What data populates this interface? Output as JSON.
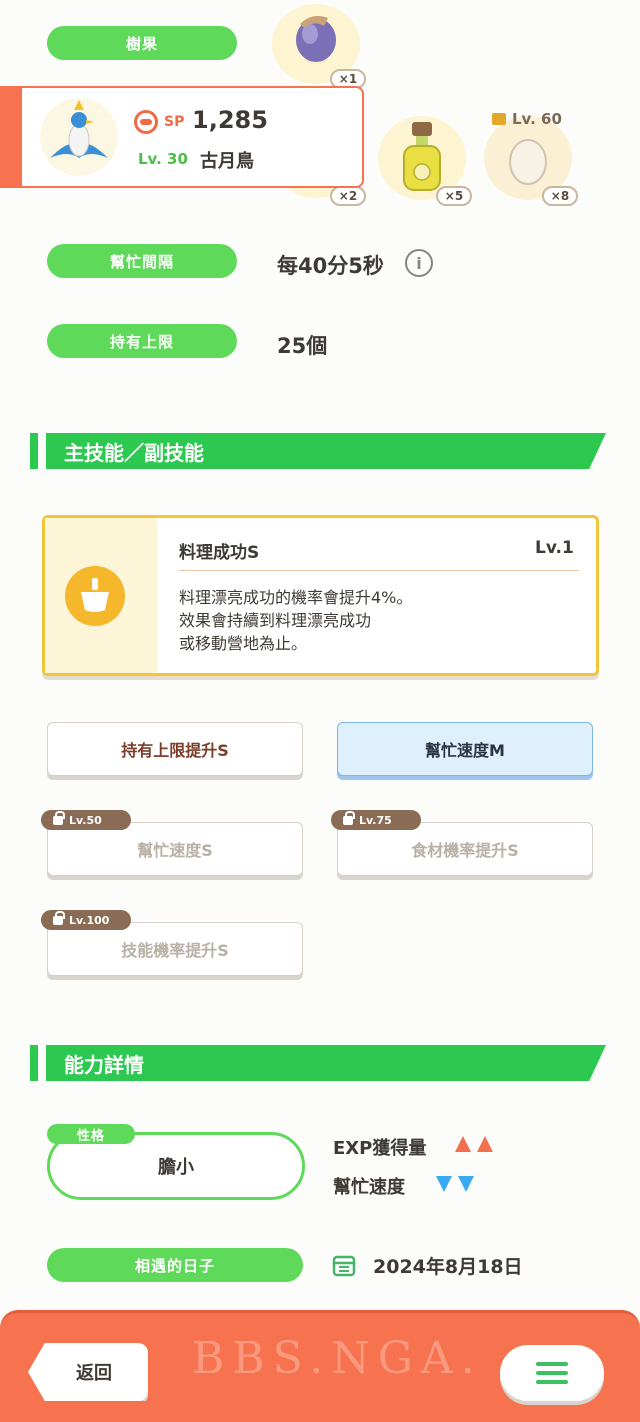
{
  "berry": {
    "label": "樹果",
    "count": "×1"
  },
  "pokemon": {
    "sp_label": "SP",
    "sp_value": "1,285",
    "level": "Lv. 30",
    "name": "古月鳥"
  },
  "ingredients": [
    {
      "icon": "berry-icon",
      "count": "×2"
    },
    {
      "icon": "oil-bottle-icon",
      "count": "×5"
    },
    {
      "icon": "egg-icon",
      "count": "×8",
      "lock": "Lv. 60"
    }
  ],
  "help_interval": {
    "label": "幫忙間隔",
    "value": "每40分5秒"
  },
  "carry_limit": {
    "label": "持有上限",
    "value": "25個"
  },
  "skills_section": {
    "title": "主技能／副技能"
  },
  "main_skill": {
    "name": "料理成功S",
    "level": "Lv.1",
    "desc_line1": "料理漂亮成功的機率會提升4%。",
    "desc_line2": "效果會持續到料理漂亮成功",
    "desc_line3": "或移動營地為止。"
  },
  "sub_skills": [
    {
      "label": "持有上限提升S",
      "lock": ""
    },
    {
      "label": "幫忙速度M",
      "lock": ""
    },
    {
      "label": "幫忙速度S",
      "lock": "Lv.50"
    },
    {
      "label": "食材機率提升S",
      "lock": "Lv.75"
    },
    {
      "label": "技能機率提升S",
      "lock": "Lv.100"
    }
  ],
  "ability_section": {
    "title": "能力詳情"
  },
  "nature": {
    "tag": "性格",
    "value": "膽小",
    "up_stat": "EXP獲得量",
    "down_stat": "幫忙速度"
  },
  "met_date": {
    "label": "相遇的日子",
    "value": "2024年8月18日"
  },
  "footer": {
    "back_label": "返回",
    "watermark": "BBS.NGA."
  },
  "colors": {
    "accent_green": "#5fd95a",
    "section_green": "#2cc84f",
    "footer": "#f7734f",
    "up": "#f0704f",
    "down": "#3ba9f0"
  }
}
